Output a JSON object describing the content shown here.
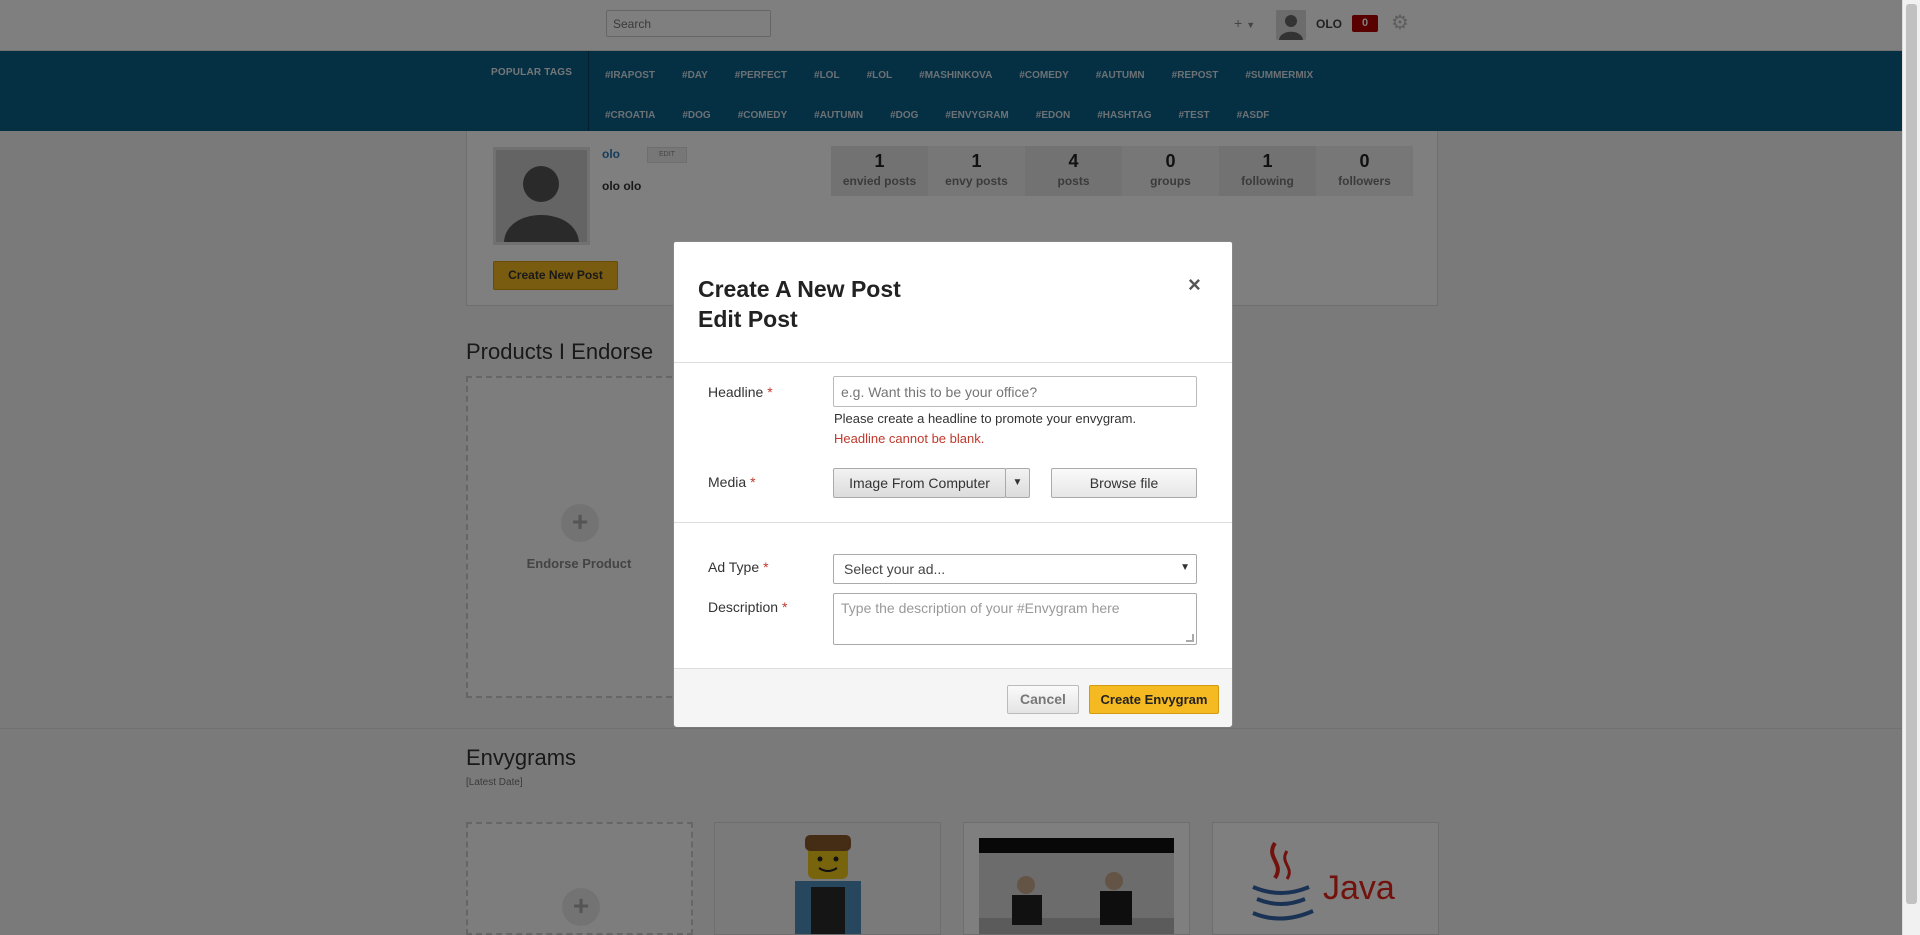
{
  "topbar": {
    "search_placeholder": "Search",
    "plus_label": "+",
    "user_name": "OLO",
    "notification_count": "0"
  },
  "tags": {
    "label": "POPULAR TAGS",
    "row1": [
      "#IRAPOST",
      "#DAY",
      "#PERFECT",
      "#LOL",
      "#LOL",
      "#MASHINKOVA",
      "#COMEDY",
      "#AUTUMN",
      "#REPOST",
      "#SUMMERMIX"
    ],
    "row2": [
      "#CROATIA",
      "#DOG",
      "#COMEDY",
      "#AUTUMN",
      "#DOG",
      "#ENVYGRAM",
      "#EDON",
      "#HASHTAG",
      "#TEST",
      "#ASDF"
    ]
  },
  "profile": {
    "username": "olo",
    "edit_label": "EDIT",
    "full_name": "olo olo",
    "create_post_label": "Create New Post",
    "stats": [
      {
        "num": "1",
        "label": "envied posts"
      },
      {
        "num": "1",
        "label": "envy posts"
      },
      {
        "num": "4",
        "label": "posts"
      },
      {
        "num": "0",
        "label": "groups"
      },
      {
        "num": "1",
        "label": "following"
      },
      {
        "num": "0",
        "label": "followers"
      }
    ]
  },
  "products": {
    "title": "Products I Endorse",
    "endorse_label": "Endorse Product"
  },
  "envygrams": {
    "title": "Envygrams",
    "sort_label": "[Latest Date]",
    "java_text": "Java"
  },
  "modal": {
    "title_line1": "Create A New Post",
    "title_line2": "Edit Post",
    "close": "×",
    "headline_label": "Headline",
    "headline_placeholder": "e.g. Want this to be your office?",
    "headline_help": "Please create a headline to promote your envygram.",
    "headline_error": "Headline cannot be blank.",
    "media_label": "Media",
    "media_source": "Image From Computer",
    "browse_label": "Browse file",
    "adtype_label": "Ad Type",
    "adtype_value": "Select your ad...",
    "description_label": "Description",
    "description_placeholder": "Type the description of your #Envygram here",
    "required_mark": "*",
    "cancel_label": "Cancel",
    "create_label": "Create Envygram"
  },
  "colors": {
    "accent": "#f5b921",
    "tags_bg": "#0a5e86",
    "error": "#c0392b",
    "link": "#2a7ab8"
  }
}
